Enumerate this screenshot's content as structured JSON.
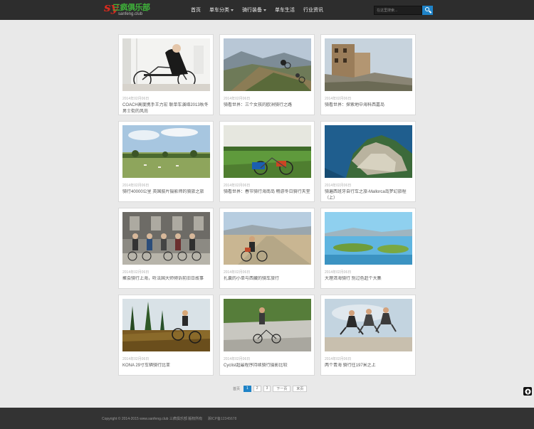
{
  "header": {
    "logo_mark": "sy",
    "logo_title": "三疯俱乐部",
    "logo_sub": "sanfeng.club",
    "nav": [
      {
        "label": "首页",
        "has_caret": false
      },
      {
        "label": "单车分类",
        "has_caret": true
      },
      {
        "label": "骑行装备",
        "has_caret": true
      },
      {
        "label": "单车生活",
        "has_caret": false
      },
      {
        "label": "行业资讯",
        "has_caret": false
      }
    ],
    "search_placeholder": "在这里搜索..."
  },
  "cards": [
    {
      "date": "2014年02月06日",
      "title": "COACH高度携手王力宏 联单车演绎2013秋冬男士街的风尚"
    },
    {
      "date": "2014年02月06日",
      "title": "骑看世界：三个女孩的欧洲骑行之路"
    },
    {
      "date": "2014年02月06日",
      "title": "骑看世界：探索地中海科西嘉岛"
    },
    {
      "date": "2014年02月06日",
      "title": "骑行40000公里 英国肢片摄影师的骑旅之旅"
    },
    {
      "date": "2014年02月06日",
      "title": "骑看世界：春节骑行海南岛 畅游冬日骑行天堂"
    },
    {
      "date": "2014年02月06日",
      "title": "骑遍西班牙自行车之旅-Mallorca岛梦幻旅程（上）"
    },
    {
      "date": "2014年02月06日",
      "title": "聚会骑行上海，听法国大师倾诉前旧日故事"
    },
    {
      "date": "2014年02月06日",
      "title": "扎囊的小单与西藏的骑车旅行"
    },
    {
      "date": "2014年02月06日",
      "title": "大理洱海骑行 别过色赶个大集"
    },
    {
      "date": "2014年02月06日",
      "title": "KONA 29寸车辆骑行比亚"
    },
    {
      "date": "2014年02月06日",
      "title": "Cyclist超最程序持续骑行摄影比较"
    },
    {
      "date": "2014年02月06日",
      "title": "两个青海 骑行往197米之上"
    }
  ],
  "pager": {
    "label": "首页",
    "pages": [
      "1",
      "2",
      "3"
    ],
    "active": "1",
    "next": "下一页",
    "last": "末页"
  },
  "footer": {
    "copyright": "Copyright © 2014-2015 www.sanfeng.club 三疯俱乐部 版权所有",
    "icp": "湘ICP备12345678"
  },
  "colors": {
    "header_bg": "#2d2d2d",
    "accent": "#1f83c7",
    "page_bg": "#e9e9e9",
    "footer_bg": "#333333"
  }
}
